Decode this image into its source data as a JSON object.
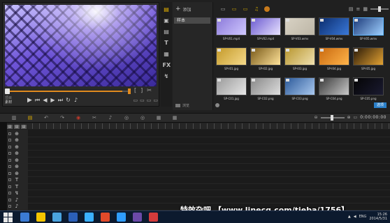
{
  "preview": {
    "mode_project": "项目",
    "mode_clip": "素材",
    "marks": [
      "[",
      "]",
      "✂"
    ],
    "right_controls": [
      "▭",
      "▭",
      "▭",
      "▭"
    ]
  },
  "library": {
    "side_icons": [
      "▤",
      "▣",
      "▤",
      "T",
      "▦",
      "FX",
      "↯"
    ],
    "add_label": "添加",
    "selected_folder": "样本",
    "browse_label": "浏览",
    "toolbar_icons": [
      "▭",
      "▭",
      "▭",
      "♫"
    ],
    "view_icons": [
      "▤",
      "≡",
      "▦"
    ],
    "options_label": "选项",
    "thumbnails": [
      {
        "caption": "SP-V01.mp4",
        "colors": [
          "#8c7ad9",
          "#cfc8ff"
        ],
        "selected": false
      },
      {
        "caption": "SP-V02.mp4",
        "colors": [
          "#6c5bd0",
          "#e8e2ff"
        ],
        "selected": false
      },
      {
        "caption": "SP-V03.wmv",
        "colors": [
          "#d8d2c4",
          "#bdb6a6"
        ],
        "selected": false
      },
      {
        "caption": "SP-V04.wmv",
        "colors": [
          "#0b2d6e",
          "#3a78d8"
        ],
        "selected": false
      },
      {
        "caption": "SP-V05.wmv",
        "colors": [
          "#1c3a7a",
          "#9fd0ff"
        ],
        "selected": true
      },
      {
        "caption": "SP-I01.jpg",
        "colors": [
          "#c49a2a",
          "#f5d98a"
        ],
        "selected": false
      },
      {
        "caption": "SP-I02.jpg",
        "colors": [
          "#7a5a1a",
          "#ffe39a"
        ],
        "selected": false
      },
      {
        "caption": "SP-I03.jpg",
        "colors": [
          "#b8962e",
          "#efe0b0"
        ],
        "selected": false
      },
      {
        "caption": "SP-I04.jpg",
        "colors": [
          "#c96a10",
          "#ffb44a"
        ],
        "selected": false
      },
      {
        "caption": "SP-I05.jpg",
        "colors": [
          "#2a1a08",
          "#e2a233"
        ],
        "selected": false
      },
      {
        "caption": "SP-C01.jpg",
        "colors": [
          "#9a9a9a",
          "#e6e6e6"
        ],
        "selected": false
      },
      {
        "caption": "SP-C02.png",
        "colors": [
          "#888",
          "#ddd"
        ],
        "selected": false
      },
      {
        "caption": "SP-C03.png",
        "colors": [
          "#2c5a9a",
          "#a9c8ee"
        ],
        "selected": false
      },
      {
        "caption": "SP-C04.png",
        "colors": [
          "#3a3a3a",
          "#c8c8c8"
        ],
        "selected": false
      },
      {
        "caption": "SP-C05.png",
        "colors": [
          "#050505",
          "#1a1a30"
        ],
        "selected": false
      }
    ]
  },
  "timeline": {
    "toolbar_icons": [
      "▥",
      "▤",
      "↶",
      "↷",
      "◉",
      "✂",
      "♪",
      "◎",
      "◎",
      "▦",
      "▦"
    ],
    "timecode": "0:00:00:00",
    "track_icons": [
      "⊕",
      "⊕",
      "⊕",
      "⊕",
      "⊕",
      "⊕",
      "⊕",
      "T",
      "T",
      "↯",
      "♪",
      "♪"
    ]
  },
  "taskbar": {
    "watermark": "特效杂吧 【www.linecg.com/tieba/1756】",
    "lang": "ENG",
    "time": "15:26",
    "date": "2014/5/31",
    "task_colors": [
      "#3b7bd4",
      "#f2c400",
      "#4aa3df",
      "#2b5fb8",
      "#3bb0ff",
      "#e04a2a",
      "#2f9dff",
      "#6b4aa8",
      "#d43b3b"
    ]
  }
}
